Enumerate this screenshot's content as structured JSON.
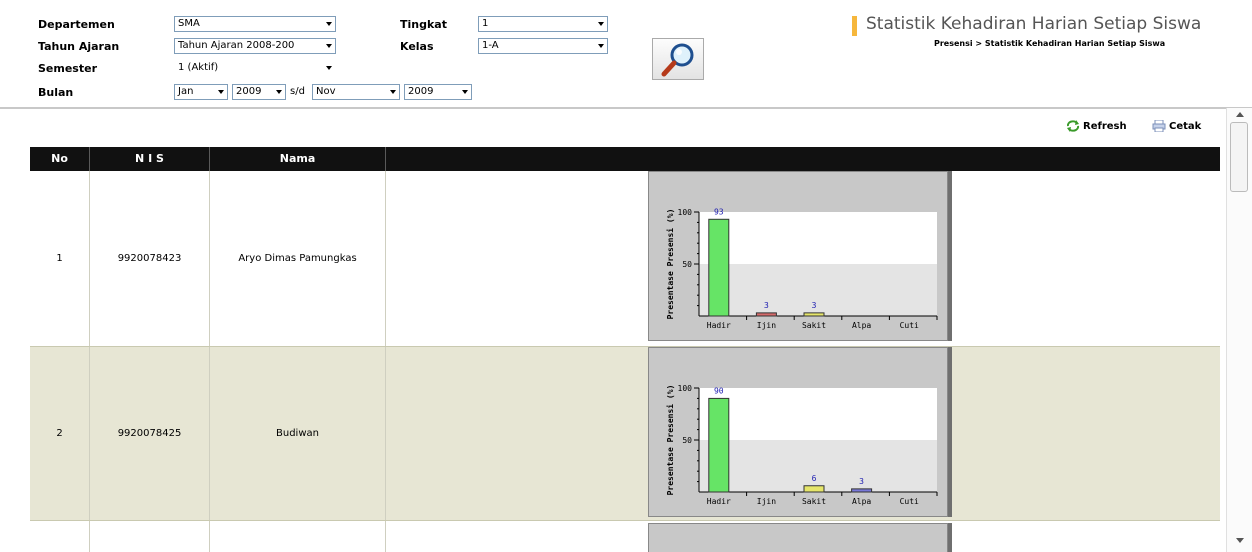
{
  "filters": {
    "departemen": {
      "label": "Departemen",
      "value": "SMA"
    },
    "tahun_ajaran": {
      "label": "Tahun Ajaran",
      "value": "Tahun Ajaran 2008-200"
    },
    "semester": {
      "label": "Semester",
      "value": "1 (Aktif)"
    },
    "bulan": {
      "label": "Bulan",
      "from_month": "Jan",
      "from_year": "2009",
      "separator": "s/d",
      "to_month": "Nov",
      "to_year": "2009"
    },
    "tingkat": {
      "label": "Tingkat",
      "value": "1"
    },
    "kelas": {
      "label": "Kelas",
      "value": "1-A"
    },
    "search_icon": "magnifier-icon"
  },
  "header": {
    "title": "Statistik Kehadiran Harian Setiap Siswa",
    "breadcrumb": "Presensi > Statistik Kehadiran Harian Setiap Siswa",
    "accent": "#f6b73c"
  },
  "toolbar": {
    "refresh_label": "Refresh",
    "print_label": "Cetak"
  },
  "table": {
    "columns": [
      "No",
      "N I S",
      "Nama",
      ""
    ],
    "rows": [
      {
        "no": "1",
        "nis": "9920078423",
        "nama": "Aryo Dimas Pamungkas"
      },
      {
        "no": "2",
        "nis": "9920078425",
        "nama": "Budiwan"
      }
    ],
    "row_colors": [
      "#ffffff",
      "#e7e6d4"
    ]
  },
  "chart_data": [
    {
      "type": "bar",
      "ylabel": "Presentase Presensi (%)",
      "categories": [
        "Hadir",
        "Ijin",
        "Sakit",
        "Alpa",
        "Cuti"
      ],
      "values": [
        93,
        3,
        3,
        0,
        0
      ],
      "data_labels": [
        "93",
        "3",
        "3",
        "",
        ""
      ],
      "yticks": [
        "100",
        "50"
      ],
      "ylim": [
        0,
        100
      ],
      "colors": [
        "#66e466",
        "#d46a6a",
        "#e6e66a",
        "#7878d8",
        "#aaaaaa"
      ]
    },
    {
      "type": "bar",
      "ylabel": "Presentase Presensi (%)",
      "categories": [
        "Hadir",
        "Ijin",
        "Sakit",
        "Alpa",
        "Cuti"
      ],
      "values": [
        90,
        0,
        6,
        3,
        0
      ],
      "data_labels": [
        "90",
        "",
        "6",
        "3",
        ""
      ],
      "yticks": [
        "100",
        "50"
      ],
      "ylim": [
        0,
        100
      ],
      "colors": [
        "#66e466",
        "#d46a6a",
        "#e6e66a",
        "#7878d8",
        "#aaaaaa"
      ]
    }
  ]
}
